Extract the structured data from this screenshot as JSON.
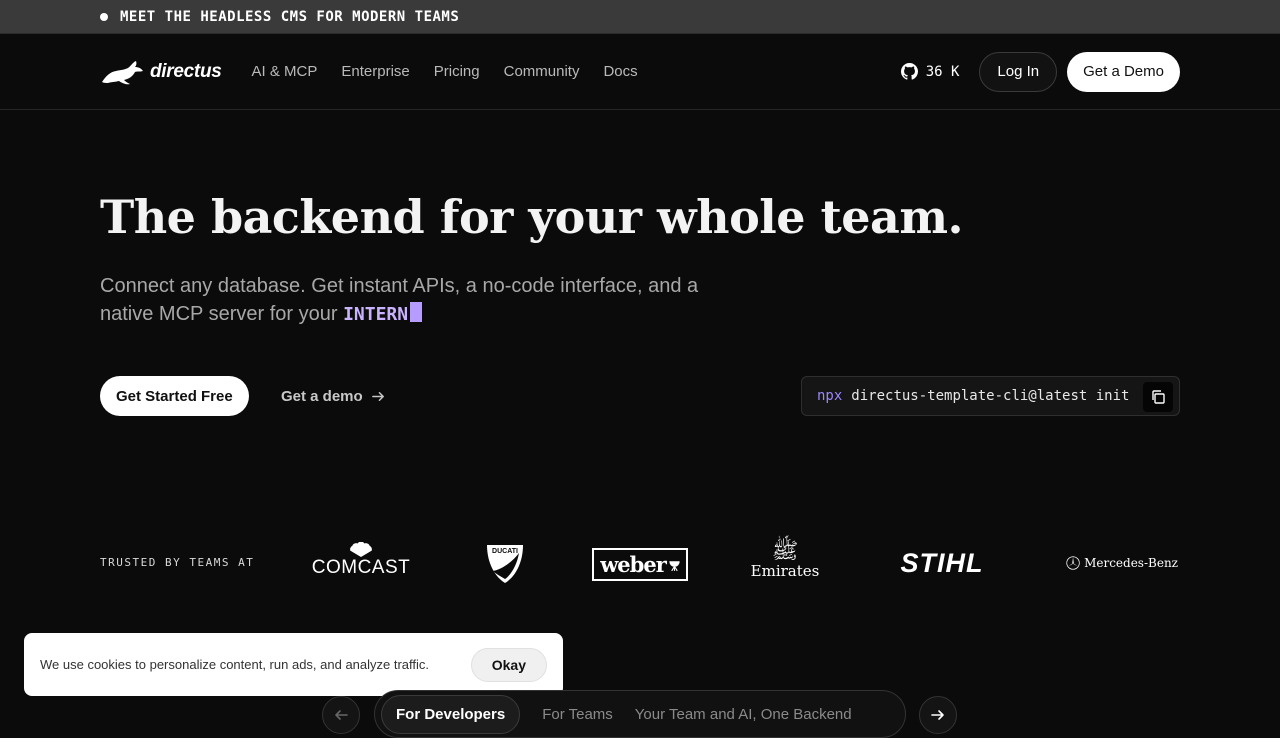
{
  "banner": {
    "text": "MEET THE HEADLESS CMS FOR MODERN TEAMS"
  },
  "nav": {
    "logo": "directus",
    "links": [
      "AI & MCP",
      "Enterprise",
      "Pricing",
      "Community",
      "Docs"
    ],
    "github_stars": "36 K",
    "login": "Log In",
    "demo": "Get a Demo"
  },
  "hero": {
    "title": "The backend for your whole team.",
    "subtitle_line1": "Connect any database. Get instant APIs, a no-code interface, and a",
    "subtitle_line2": "native MCP server for your",
    "typed_word": "INTERN",
    "cta_primary": "Get Started Free",
    "cta_secondary": "Get a demo",
    "cli_prefix": "npx",
    "cli_command": "directus-template-cli@latest init"
  },
  "trusted": {
    "label": "TRUSTED BY TEAMS AT",
    "brands": [
      "COMCAST",
      "DUCATI",
      "weber",
      "Emirates",
      "STIHL",
      "Mercedes-Benz"
    ]
  },
  "cookie": {
    "text": "We use cookies to personalize content, run ads, and analyze traffic.",
    "button": "Okay"
  },
  "tabs": [
    "For Developers",
    "For Teams",
    "Your Team and AI, One Backend"
  ],
  "colors": {
    "accent": "#b79cff",
    "background": "#0b0b0b",
    "banner": "#3a3a3a"
  }
}
